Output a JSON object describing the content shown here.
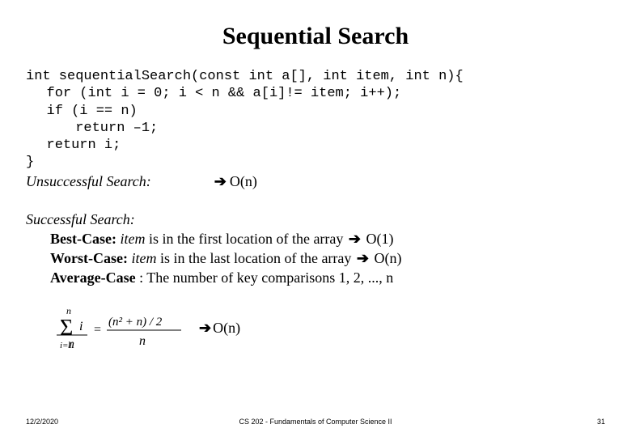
{
  "title": "Sequential Search",
  "code": {
    "line1": "int sequentialSearch(const int a[], int item, int n){",
    "line2": "for (int i = 0; i < n && a[i]!= item; i++);",
    "line3": "if (i == n)",
    "line4": " return –1;",
    "line5": "return i;",
    "line6": "}"
  },
  "unsuccessful": {
    "label": "Unsuccessful Search:",
    "arrow": "➔",
    "complexity": "O(n)"
  },
  "successful": {
    "label": "Successful Search:",
    "best": {
      "name": "Best-Case:",
      "desc_prefix": "item",
      "desc_rest": " is in the first location of the array ",
      "arrow": "➔",
      "complexity": "O(1)"
    },
    "worst": {
      "name": "Worst-Case:",
      "desc_prefix": "item",
      "desc_rest": " is in the last location of the array ",
      "arrow": "➔",
      "complexity": "O(n)"
    },
    "average": {
      "name": "Average-Case",
      "desc": ": The number of key comparisons 1, 2, ..., n"
    }
  },
  "formula": {
    "sigma_upper": "n",
    "sigma_lower": "i=1",
    "sigma_body": "i",
    "denom": "n",
    "eq": "=",
    "num2": "(n² + n) / 2",
    "denom2": "n",
    "arrow": "➔",
    "complexity": "O(n)"
  },
  "footer": {
    "date": "12/2/2020",
    "center": "CS 202 - Fundamentals of Computer Science II",
    "page": "31"
  }
}
